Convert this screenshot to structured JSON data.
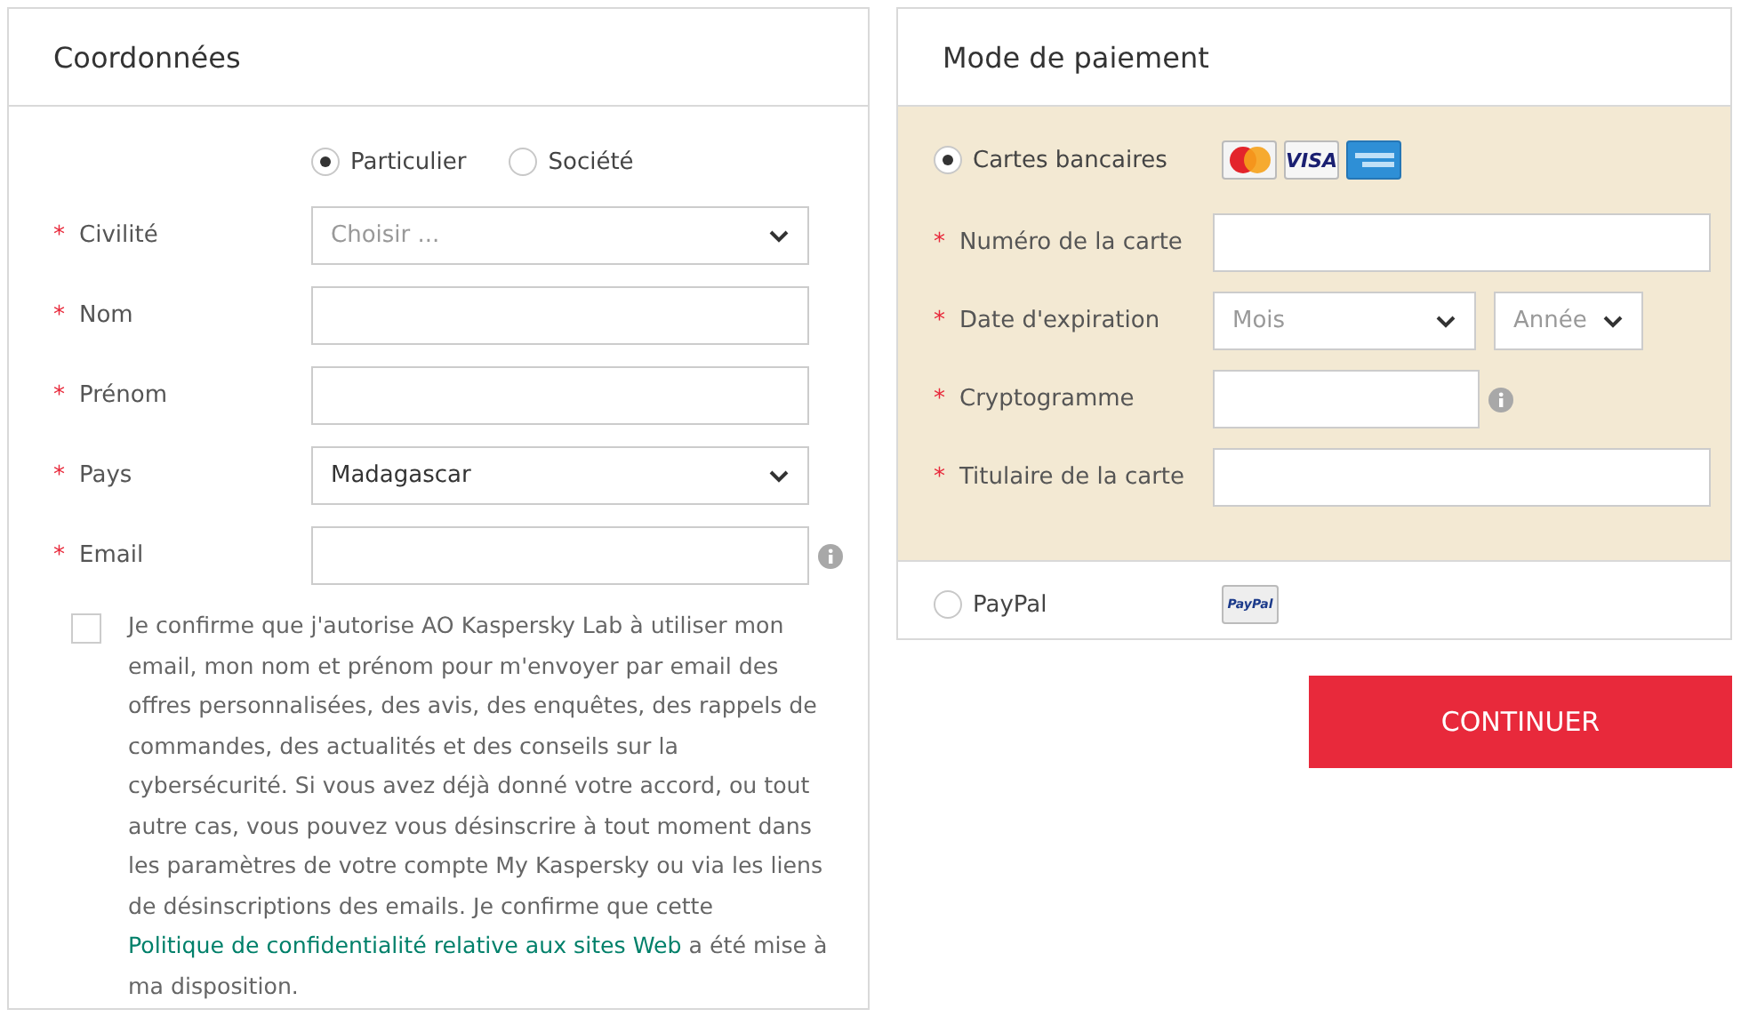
{
  "required_mark": "*",
  "contact": {
    "title": "Coordonnées",
    "customer_type": [
      {
        "label": "Particulier",
        "selected": true
      },
      {
        "label": "Société",
        "selected": false
      }
    ],
    "fields": [
      {
        "kind": "select",
        "label": "Civilité",
        "required": true,
        "placeholder": "Choisir ..."
      },
      {
        "kind": "text",
        "label": "Nom",
        "required": true
      },
      {
        "kind": "text",
        "label": "Prénom",
        "required": true
      },
      {
        "kind": "select",
        "label": "Pays",
        "required": true,
        "value": "Madagascar"
      },
      {
        "kind": "text",
        "label": "Email",
        "required": true,
        "info": true
      }
    ],
    "consent": {
      "checked": false,
      "text": "Je confirme que j'autorise AO Kaspersky Lab à utiliser mon email, mon nom et prénom pour m'envoyer par email des offres personnalisées, des avis, des enquêtes, des rappels de commandes, des actualités et des conseils sur la cybersécurité. Si vous avez déjà donné votre accord, ou tout autre cas, vous pouvez vous désinscrire à tout moment dans les paramètres de votre compte My Kaspersky ou via les liens de désinscriptions des emails. Je confirme que cette ",
      "link": "Politique de confidentialité relative aux sites Web",
      "after": " a été mise à ma disposition."
    }
  },
  "payment": {
    "title": "Mode de paiement",
    "methods": [
      {
        "label": "Cartes bancaires",
        "selected": true,
        "logos": [
          {
            "kind": "mastercard"
          },
          {
            "kind": "visa",
            "text": "VISA"
          },
          {
            "kind": "amex"
          }
        ],
        "fields": [
          {
            "kind": "text",
            "label": "Numéro de la carte",
            "required": true
          },
          {
            "kind": "expiry",
            "label": "Date d'expiration",
            "required": true,
            "month_placeholder": "Mois",
            "year_placeholder": "Année"
          },
          {
            "kind": "short",
            "label": "Cryptogramme",
            "required": true,
            "info": true
          },
          {
            "kind": "text",
            "label": "Titulaire de la carte",
            "required": true
          }
        ]
      },
      {
        "label": "PayPal",
        "selected": false,
        "logos": [
          {
            "kind": "paypal",
            "text": "PayPal"
          }
        ]
      }
    ]
  },
  "button": "CONTINUER"
}
